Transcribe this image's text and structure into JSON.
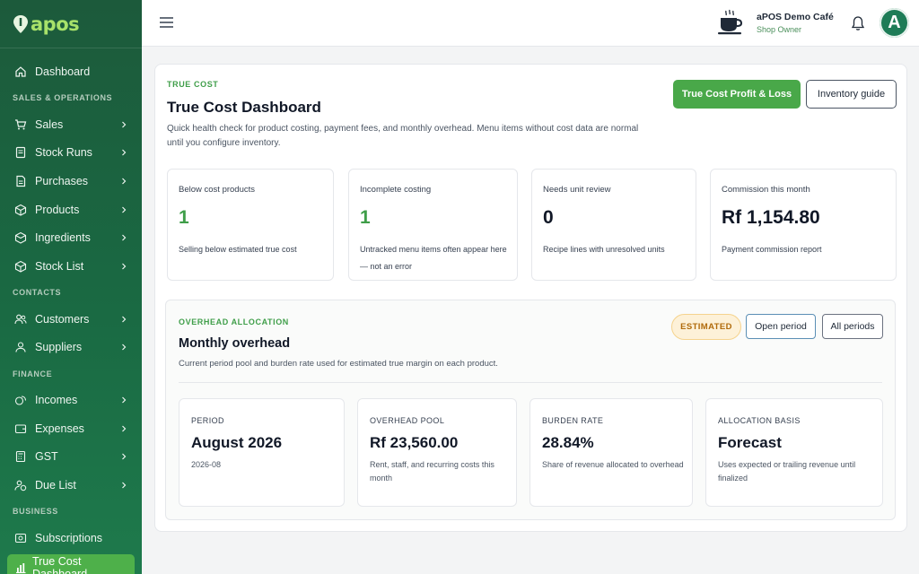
{
  "app": {
    "logo_text": "apos"
  },
  "sidebar": {
    "dashboard": "Dashboard",
    "sections": {
      "sales_ops": "SALES & OPERATIONS",
      "contacts": "CONTACTS",
      "finance": "FINANCE",
      "business": "BUSINESS"
    },
    "items": {
      "sales": "Sales",
      "stock_runs": "Stock Runs",
      "purchases": "Purchases",
      "products": "Products",
      "ingredients": "Ingredients",
      "stock_list": "Stock List",
      "customers": "Customers",
      "suppliers": "Suppliers",
      "incomes": "Incomes",
      "expenses": "Expenses",
      "gst": "GST",
      "due_list": "Due List",
      "subscriptions": "Subscriptions",
      "true_cost": "True Cost Dashboard"
    }
  },
  "topbar": {
    "shop_name": "aPOS Demo Café",
    "shop_role": "Shop Owner",
    "avatar_initial": "A"
  },
  "page": {
    "eyebrow": "TRUE COST",
    "title": "True Cost Dashboard",
    "description": "Quick health check for product costing, payment fees, and monthly overhead. Menu items without cost data are normal until you configure inventory.",
    "primary_button": "True Cost Profit & Loss",
    "secondary_button": "Inventory guide"
  },
  "stats": [
    {
      "label": "Below cost products",
      "value": "1",
      "note": "Selling below estimated true cost"
    },
    {
      "label": "Incomplete costing",
      "value": "1",
      "note": "Untracked menu items often appear here — not an error"
    },
    {
      "label": "Needs unit review",
      "value": "0",
      "note": "Recipe lines with unresolved units"
    },
    {
      "label": "Commission this month",
      "value": "Rf 1,154.80",
      "note": "Payment commission report"
    }
  ],
  "overhead": {
    "eyebrow": "OVERHEAD ALLOCATION",
    "title": "Monthly overhead",
    "description": "Current period pool and burden rate used for estimated true margin on each product.",
    "badge": "ESTIMATED",
    "open_period": "Open period",
    "all_periods": "All periods",
    "cards": [
      {
        "label": "PERIOD",
        "value": "August 2026",
        "note": "2026-08"
      },
      {
        "label": "OVERHEAD POOL",
        "value": "Rf 23,560.00",
        "note": "Rent, staff, and recurring costs this month"
      },
      {
        "label": "BURDEN RATE",
        "value": "28.84%",
        "note": "Share of revenue allocated to overhead"
      },
      {
        "label": "ALLOCATION BASIS",
        "value": "Forecast",
        "note": "Uses expected or trailing revenue until finalized"
      }
    ]
  },
  "colors": {
    "primary": "#49a849",
    "sidebar": "#1c5a3b",
    "accent_text": "#3f9e49",
    "badge_bg": "#fdf1d8",
    "badge_text": "#b06a0a"
  }
}
